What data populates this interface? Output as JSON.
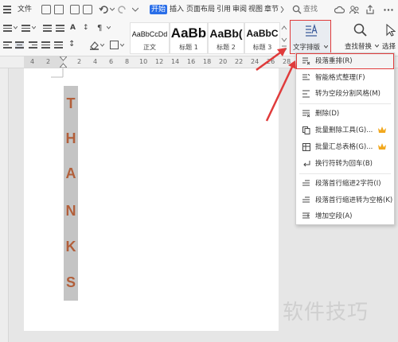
{
  "topbar": {
    "file_label": "文件",
    "tabs": [
      "开始",
      "插入",
      "页面布局",
      "引用",
      "审阅",
      "视图",
      "章节"
    ],
    "search_label": "查找"
  },
  "ribbon": {
    "styles": [
      {
        "preview": "AaBbCcDd",
        "caption": "正文"
      },
      {
        "preview": "AaBb",
        "caption": "标题 1"
      },
      {
        "preview": "AaBb(",
        "caption": "标题 2"
      },
      {
        "preview": "AaBbC",
        "caption": "标题 3"
      }
    ],
    "text_layout_label": "文字排版",
    "find_replace_label": "查找替换",
    "select_label": "选择"
  },
  "ruler": {
    "numbers": [
      "4",
      "2",
      "2",
      "4",
      "6",
      "8",
      "10",
      "12",
      "14",
      "16",
      "18",
      "20",
      "22",
      "24",
      "26",
      "28"
    ]
  },
  "document": {
    "letters": [
      "T",
      "H",
      "A",
      "N",
      "K",
      "S"
    ]
  },
  "menu": {
    "items": [
      {
        "label": "段落重排(R)",
        "icon": "paragraph-rearrange-icon",
        "highlight": true,
        "crown": false
      },
      {
        "label": "智能格式整理(F)",
        "icon": "smart-format-icon",
        "highlight": false,
        "crown": false
      },
      {
        "label": "转为空段分割风格(M)",
        "icon": "empty-paragraph-split-icon",
        "highlight": false,
        "crown": false
      },
      {
        "label": "删除(D)",
        "icon": "delete-lines-icon",
        "highlight": false,
        "crown": false
      },
      {
        "label": "批量删除工具(G)...",
        "icon": "batch-delete-icon",
        "highlight": false,
        "crown": true
      },
      {
        "label": "批量汇总表格(G)...",
        "icon": "batch-table-icon",
        "highlight": false,
        "crown": true
      },
      {
        "label": "换行符转为回车(B)",
        "icon": "linebreak-to-enter-icon",
        "highlight": false,
        "crown": false
      },
      {
        "label": "段落首行缩进2字符(I)",
        "icon": "indent-first-line-icon",
        "highlight": false,
        "crown": false
      },
      {
        "label": "段落首行缩进转为空格(K)",
        "icon": "indent-to-space-icon",
        "highlight": false,
        "crown": false
      },
      {
        "label": "增加空段(A)",
        "icon": "add-empty-paragraph-icon",
        "highlight": false,
        "crown": false
      }
    ]
  },
  "watermark": "软件技巧",
  "colors": {
    "accent": "#2a6ee8",
    "highlight": "#e03b3b",
    "letter": "#b25f3a",
    "crown": "#f2a81d"
  }
}
